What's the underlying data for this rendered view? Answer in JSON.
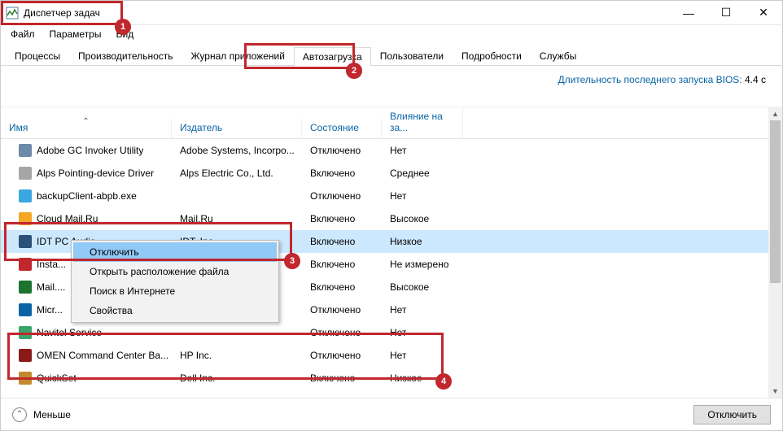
{
  "window": {
    "title": "Диспетчер задач"
  },
  "menu": {
    "file": "Файл",
    "options": "Параметры",
    "view": "Вид"
  },
  "tabs": {
    "processes": "Процессы",
    "performance": "Производительность",
    "app_history": "Журнал приложений",
    "startup": "Автозагрузка",
    "users": "Пользователи",
    "details": "Подробности",
    "services": "Службы"
  },
  "bios": {
    "label": "Длительность последнего запуска BIOS:",
    "value": "4.4 с"
  },
  "columns": {
    "name": "Имя",
    "publisher": "Издатель",
    "state": "Состояние",
    "impact": "Влияние на за..."
  },
  "rows": [
    {
      "icon_color": "#6d8aa8",
      "name": "Adobe GC Invoker Utility",
      "publisher": "Adobe Systems, Incorpo...",
      "state": "Отключено",
      "impact": "Нет"
    },
    {
      "icon_color": "#a6a6a6",
      "name": "Alps Pointing-device Driver",
      "publisher": "Alps Electric Co., Ltd.",
      "state": "Включено",
      "impact": "Среднее"
    },
    {
      "icon_color": "#3aa7e0",
      "name": "backupClient-abpb.exe",
      "publisher": "",
      "state": "Отключено",
      "impact": "Нет"
    },
    {
      "icon_color": "#f5a623",
      "name": "Cloud Mail.Ru",
      "publisher": "Mail.Ru",
      "state": "Включено",
      "impact": "Высокое"
    },
    {
      "icon_color": "#29517a",
      "name": "IDT PC Audio",
      "publisher": "IDT, Inc.",
      "state": "Включено",
      "impact": "Низкое"
    },
    {
      "icon_color": "#c1272d",
      "name": "Insta...",
      "publisher": "",
      "state": "Включено",
      "impact": "Не измерено"
    },
    {
      "icon_color": "#1c7430",
      "name": "Mail....",
      "publisher": "",
      "state": "Включено",
      "impact": "Высокое"
    },
    {
      "icon_color": "#0a64a4",
      "name": "Micr...",
      "publisher": "",
      "state": "Отключено",
      "impact": "Нет"
    },
    {
      "icon_color": "#3aa46a",
      "name": "Navitel Service",
      "publisher": "",
      "state": "Отключено",
      "impact": "Нет"
    },
    {
      "icon_color": "#8a1a1a",
      "name": "OMEN Command Center Ba...",
      "publisher": "HP Inc.",
      "state": "Отключено",
      "impact": "Нет"
    },
    {
      "icon_color": "#c28a2e",
      "name": "QuickSet",
      "publisher": "Dell Inc.",
      "state": "Включено",
      "impact": "Низкое"
    }
  ],
  "selected_row_index": 4,
  "context_menu": {
    "items": [
      "Отключить",
      "Открыть расположение файла",
      "Поиск в Интернете",
      "Свойства"
    ],
    "selected_index": 0
  },
  "footer": {
    "fewer": "Меньше",
    "disable_button": "Отключить"
  },
  "annotations": {
    "b1": "1",
    "b2": "2",
    "b3": "3",
    "b4": "4"
  }
}
